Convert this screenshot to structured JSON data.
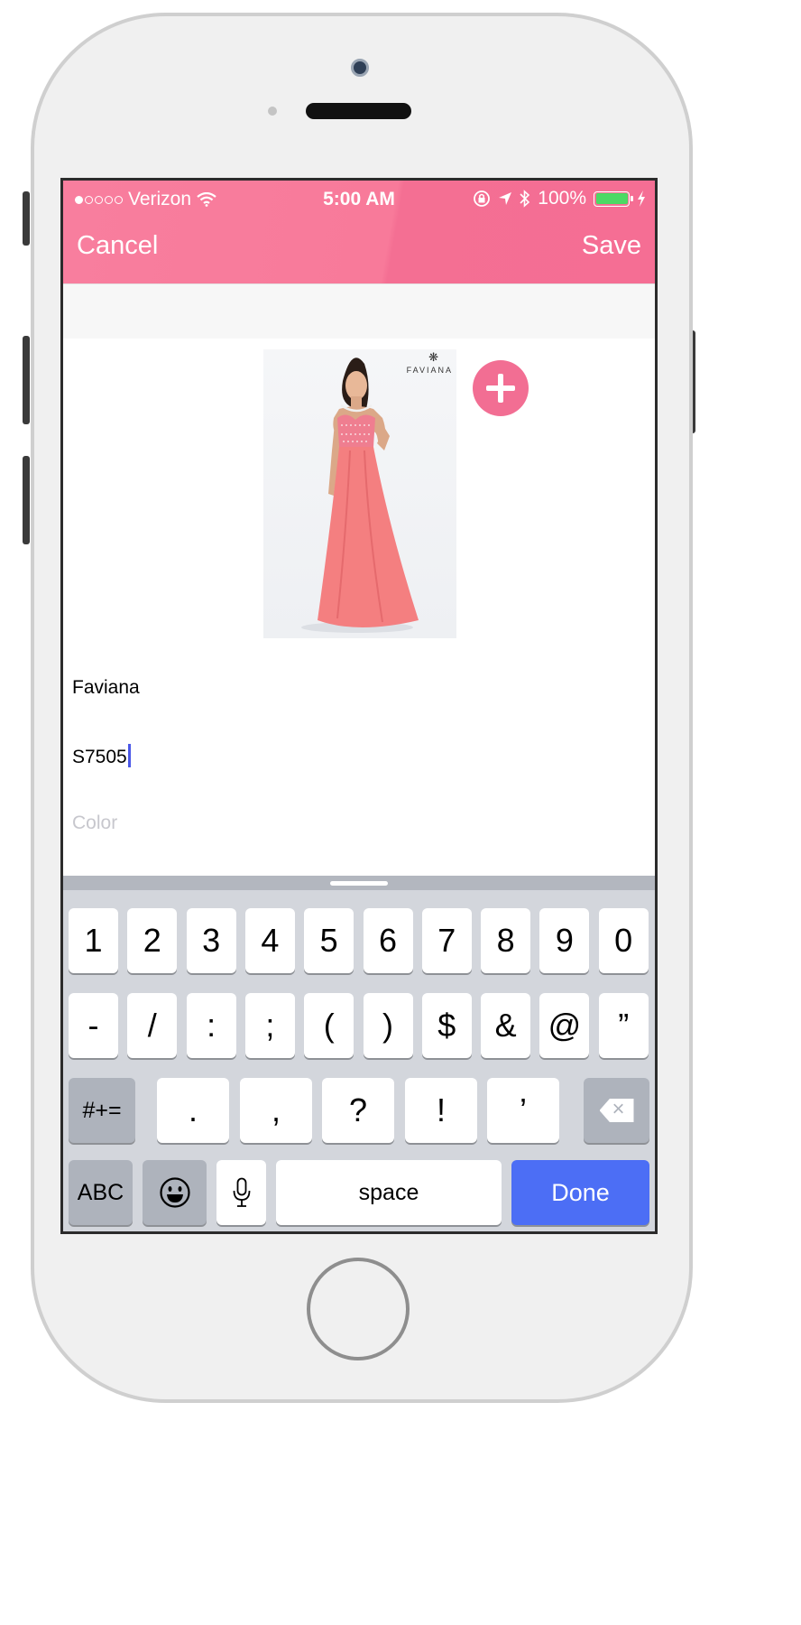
{
  "status_bar": {
    "carrier": "Verizon",
    "time": "5:00 AM",
    "battery": "100%",
    "signal_icon": "signal-dots-icon",
    "wifi_icon": "wifi-icon",
    "rotation_lock_icon": "rotation-lock-icon",
    "location_icon": "location-arrow-icon",
    "bluetooth_icon": "bluetooth-icon",
    "battery_icon": "battery-icon",
    "charging_icon": "charging-bolt-icon"
  },
  "nav": {
    "cancel": "Cancel",
    "save": "Save",
    "color": "#f77a9a"
  },
  "photo": {
    "brand": "FAVIANA"
  },
  "add_button": {
    "icon": "plus-icon",
    "color": "#f26e93"
  },
  "form": {
    "brand_value": "Faviana",
    "style_value": "S7505",
    "color_placeholder": "Color"
  },
  "keyboard": {
    "row1": [
      "1",
      "2",
      "3",
      "4",
      "5",
      "6",
      "7",
      "8",
      "9",
      "0"
    ],
    "row2": [
      "-",
      "/",
      ":",
      ";",
      "(",
      ")",
      "$",
      "&",
      "@",
      "”"
    ],
    "more_symbols": "#+=",
    "row3": [
      ".",
      ",",
      "?",
      "!",
      "’"
    ],
    "abc": "ABC",
    "emoji_icon": "emoji-icon",
    "mic_icon": "microphone-icon",
    "space": "space",
    "done": "Done",
    "done_color": "#4c6ef5"
  }
}
